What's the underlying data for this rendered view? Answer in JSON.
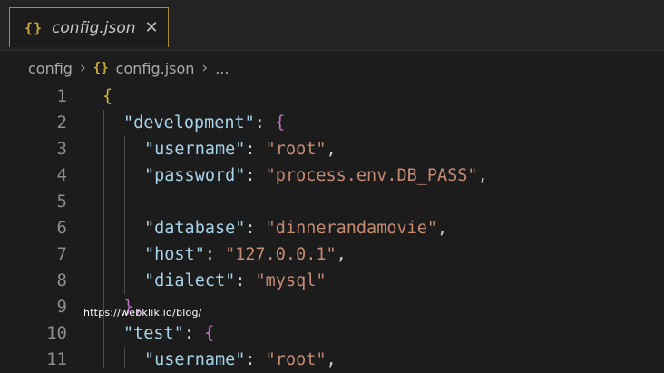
{
  "tab": {
    "icon": "{}",
    "icon_name": "json-braces-icon",
    "label": "config.json",
    "close": "✕"
  },
  "breadcrumb": {
    "folder": "config",
    "file_icon": "{}",
    "file": "config.json",
    "more": "...",
    "sep": "›"
  },
  "lines": [
    {
      "n": "1",
      "t": [
        {
          "c": "brace-y",
          "v": "{"
        }
      ]
    },
    {
      "n": "2",
      "t": [
        {
          "c": "key",
          "v": "\"development\""
        },
        {
          "c": "punct",
          "v": ": "
        },
        {
          "c": "brace-p",
          "v": "{"
        }
      ]
    },
    {
      "n": "3",
      "t": [
        {
          "c": "key",
          "v": "\"username\""
        },
        {
          "c": "punct",
          "v": ": "
        },
        {
          "c": "str",
          "v": "\"root\""
        },
        {
          "c": "punct",
          "v": ","
        }
      ]
    },
    {
      "n": "4",
      "t": [
        {
          "c": "key",
          "v": "\"password\""
        },
        {
          "c": "punct",
          "v": ": "
        },
        {
          "c": "str",
          "v": "\"process.env.DB_PASS\""
        },
        {
          "c": "punct",
          "v": ","
        }
      ]
    },
    {
      "n": "5",
      "t": []
    },
    {
      "n": "6",
      "t": [
        {
          "c": "key",
          "v": "\"database\""
        },
        {
          "c": "punct",
          "v": ": "
        },
        {
          "c": "str",
          "v": "\"dinnerandamovie\""
        },
        {
          "c": "punct",
          "v": ","
        }
      ]
    },
    {
      "n": "7",
      "t": [
        {
          "c": "key",
          "v": "\"host\""
        },
        {
          "c": "punct",
          "v": ": "
        },
        {
          "c": "str",
          "v": "\"127.0.0.1\""
        },
        {
          "c": "punct",
          "v": ","
        }
      ]
    },
    {
      "n": "8",
      "t": [
        {
          "c": "key",
          "v": "\"dialect\""
        },
        {
          "c": "punct",
          "v": ": "
        },
        {
          "c": "str",
          "v": "\"mysql\""
        }
      ]
    },
    {
      "n": "9",
      "t": [
        {
          "c": "brace-p",
          "v": "},"
        }
      ]
    },
    {
      "n": "10",
      "t": [
        {
          "c": "key",
          "v": "\"test\""
        },
        {
          "c": "punct",
          "v": ": "
        },
        {
          "c": "brace-p",
          "v": "{"
        }
      ]
    },
    {
      "n": "11",
      "t": [
        {
          "c": "key",
          "v": "\"username\""
        },
        {
          "c": "punct",
          "v": ": "
        },
        {
          "c": "str",
          "v": "\"root\""
        },
        {
          "c": "punct",
          "v": ","
        }
      ]
    }
  ],
  "watermark": "https://webklik.id/blog/",
  "colors": {
    "background": "#1c1c1c",
    "key": "#a7d3ea",
    "string": "#c58a72",
    "brace_level1": "#d2b53a",
    "brace_level2": "#bd6fc4"
  }
}
